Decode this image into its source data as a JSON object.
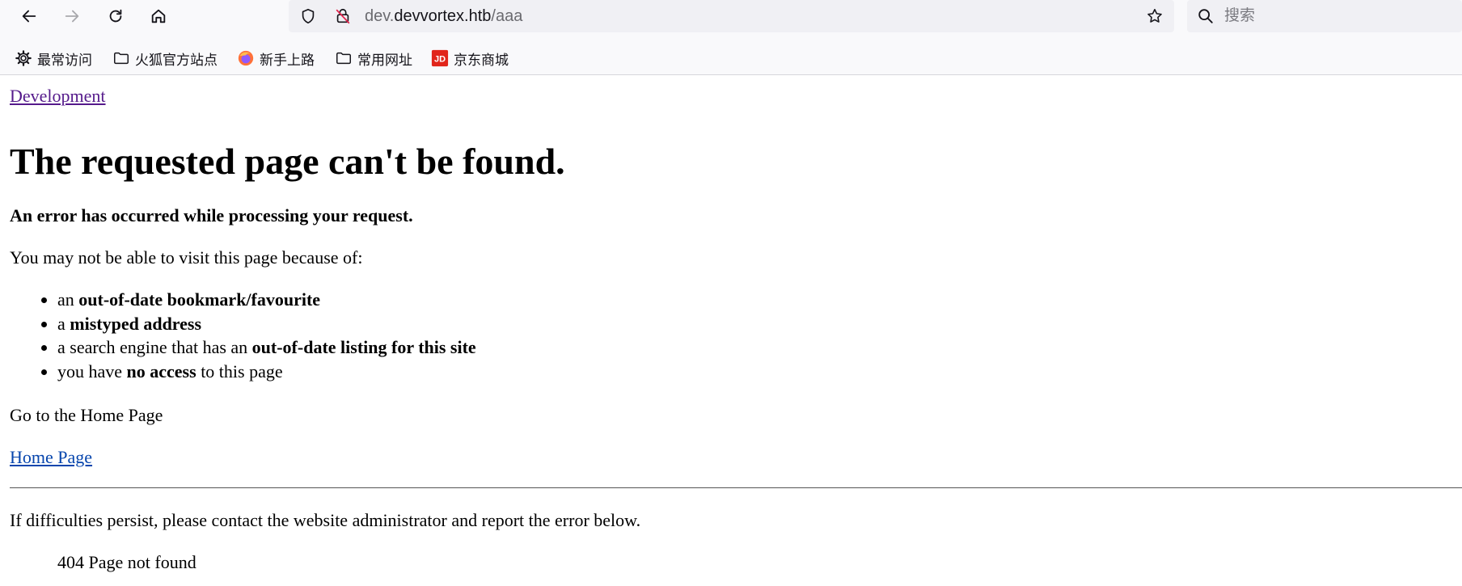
{
  "browser": {
    "url_prefix": "dev.",
    "url_host": "devvortex.htb",
    "url_path": "/aaa",
    "search_placeholder": "搜索"
  },
  "bookmarks": [
    {
      "label": "最常访问",
      "icon": "gear-icon"
    },
    {
      "label": "火狐官方站点",
      "icon": "folder-icon"
    },
    {
      "label": "新手上路",
      "icon": "firefox-icon"
    },
    {
      "label": "常用网址",
      "icon": "folder-icon"
    },
    {
      "label": "京东商城",
      "icon": "jd-icon"
    }
  ],
  "page": {
    "top_link": "Development",
    "title": "The requested page can't be found.",
    "subheading": "An error has occurred while processing your request.",
    "intro": "You may not be able to visit this page because of:",
    "reasons": [
      {
        "pre": "an ",
        "bold": "out-of-date bookmark/favourite",
        "post": ""
      },
      {
        "pre": "a ",
        "bold": "mistyped address",
        "post": ""
      },
      {
        "pre": "a search engine that has an ",
        "bold": "out-of-date listing for this site",
        "post": ""
      },
      {
        "pre": "you have ",
        "bold": "no access",
        "post": " to this page"
      }
    ],
    "go_home_text": "Go to the Home Page",
    "home_link": "Home Page",
    "persist_text": "If difficulties persist, please contact the website administrator and report the error below.",
    "error_code": "404 Page not found"
  },
  "colors": {
    "visited_link": "#551a8b",
    "link": "#0645ad",
    "jd_red": "#e1251b"
  }
}
